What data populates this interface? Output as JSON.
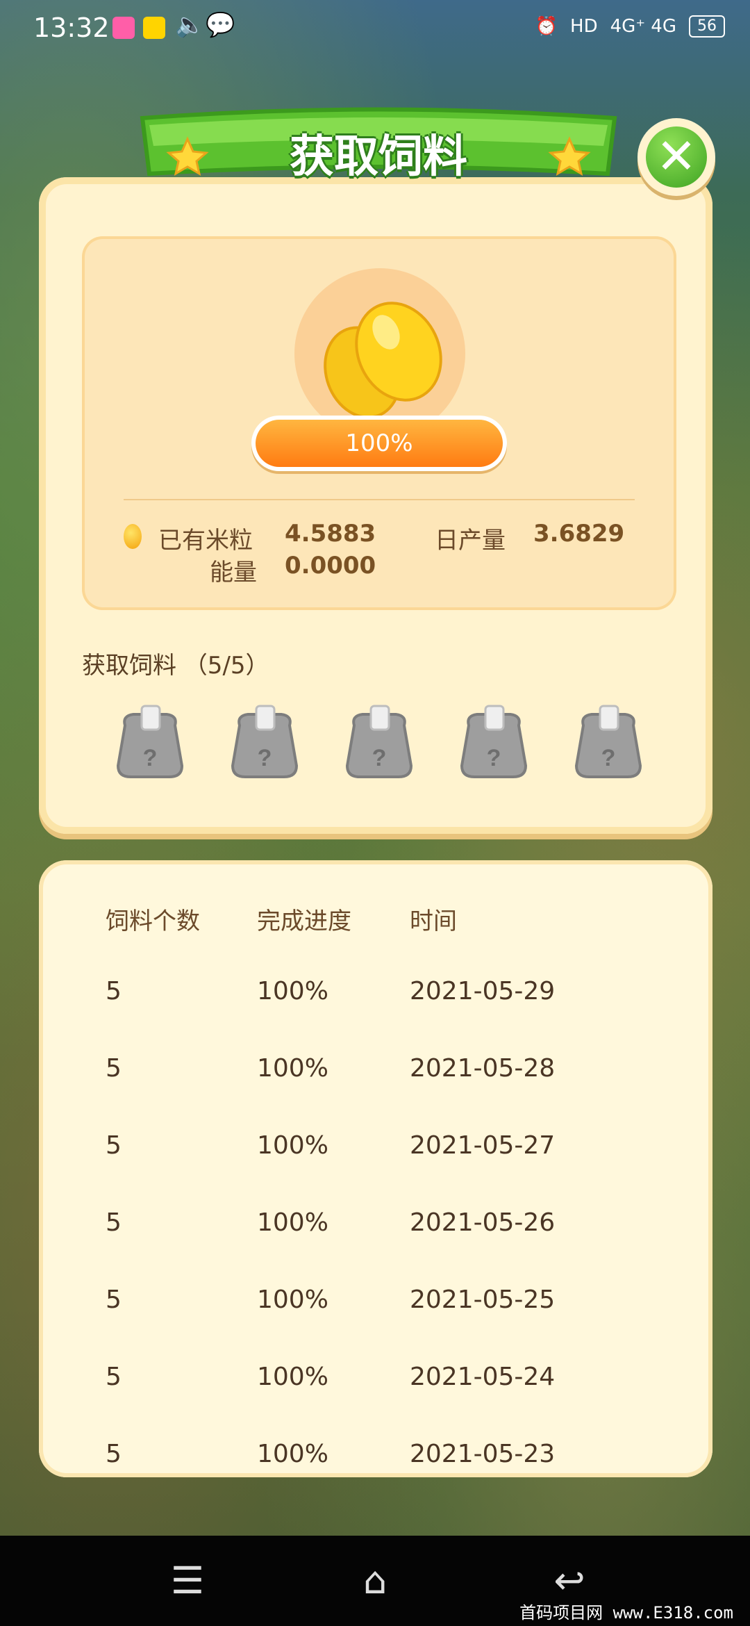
{
  "status_bar": {
    "time": "13:32",
    "network_label": "4G⁺  4G",
    "hd_label": "HD",
    "battery": "56"
  },
  "dialog": {
    "title": "获取饲料",
    "progress_percent": 100,
    "progress_label": "100%",
    "stats": {
      "rice_label": "已有米粒",
      "rice_value": "4.5883",
      "daily_label": "日产量",
      "daily_value": "3.6829",
      "energy_label": "能量",
      "energy_value": "0.0000"
    },
    "feed_section_title": "获取饲料 （5/5）",
    "bags": [
      "mystery-bag",
      "mystery-bag",
      "mystery-bag",
      "mystery-bag",
      "mystery-bag"
    ]
  },
  "history": {
    "columns": [
      "饲料个数",
      "完成进度",
      "时间"
    ],
    "rows": [
      [
        "5",
        "100%",
        "2021-05-29"
      ],
      [
        "5",
        "100%",
        "2021-05-28"
      ],
      [
        "5",
        "100%",
        "2021-05-27"
      ],
      [
        "5",
        "100%",
        "2021-05-26"
      ],
      [
        "5",
        "100%",
        "2021-05-25"
      ],
      [
        "5",
        "100%",
        "2021-05-24"
      ],
      [
        "5",
        "100%",
        "2021-05-23"
      ]
    ]
  },
  "watermark": "首码项目网 www.E318.com"
}
